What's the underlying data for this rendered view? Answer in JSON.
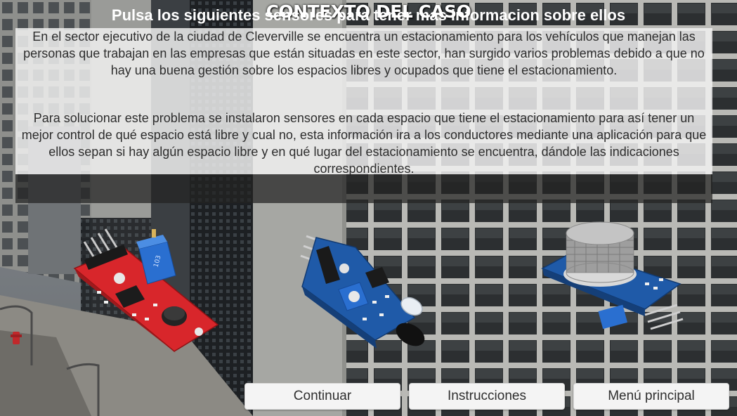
{
  "title": "CONTEXTO DEL CASO",
  "paragraph1": "En el sector ejecutivo de la ciudad de Cleverville se encuentra un estacionamiento para los vehículos que manejan las personas que trabajan en las empresas que están situadas en este sector, han surgido varios problemas debido a que no hay una buena gestión sobre los espacios libres y ocupados que tiene el estacionamiento.",
  "paragraph2": "Para solucionar este problema se instalaron sensores en cada espacio que tiene el estacionamiento para así tener un mejor control de qué espacio está libre y cual no, esta información ira a los conductores mediante una aplicación para que ellos sepan si hay algún espacio libre y en qué lugar del estacionamiento se encuentra, dándole las indicaciones correspondientes.",
  "instruction": "Pulsa los siguientes sensores para tener mas informacion sobre ellos",
  "sensors": [
    {
      "name": "sound-sensor-module",
      "potentiometer_label": "103"
    },
    {
      "name": "infrared-sensor-module"
    },
    {
      "name": "gas-sensor-module"
    }
  ],
  "buttons": {
    "continue": "Continuar",
    "instructions": "Instrucciones",
    "main_menu": "Menú principal"
  },
  "colors": {
    "panel": "#f2f2f2",
    "strip": "#232323",
    "red_board": "#d8262b",
    "blue_board": "#1f5aa8",
    "potentiometer": "#2a6fd0"
  }
}
